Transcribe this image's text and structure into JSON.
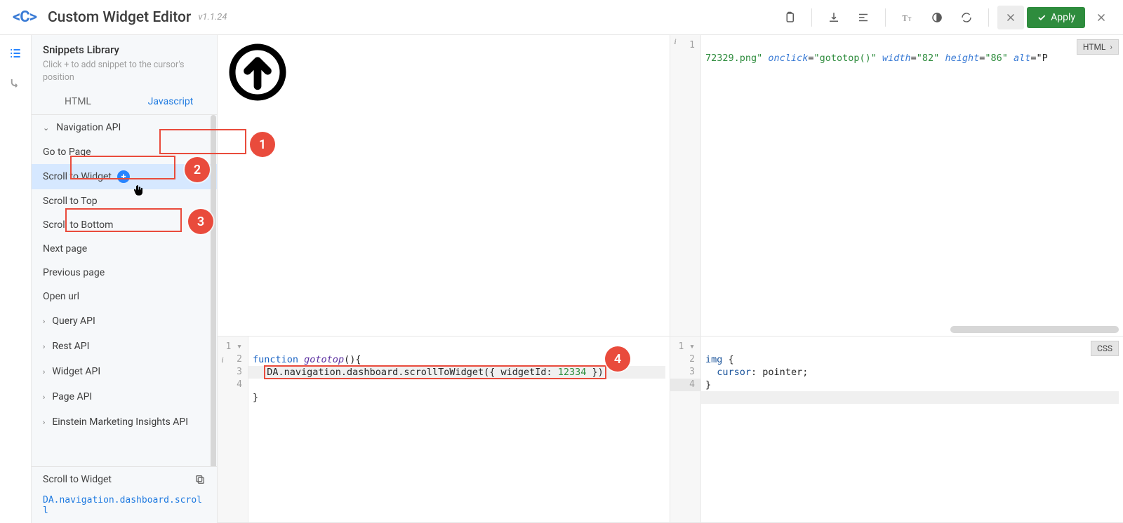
{
  "header": {
    "title": "Custom Widget Editor",
    "version": "v1.1.24",
    "apply_label": "Apply"
  },
  "sidebar": {
    "title": "Snippets Library",
    "hint": "Click + to add snippet to the cursor's position",
    "tabs": {
      "html": "HTML",
      "js": "Javascript"
    },
    "nav_api": "Navigation API",
    "items": {
      "go_to_page": "Go to Page",
      "scroll_to_widget": "Scroll to Widget",
      "scroll_to_top": "Scroll to Top",
      "scroll_to_bottom": "Scroll to Bottom",
      "next_page": "Next page",
      "previous_page": "Previous page",
      "open_url": "Open url"
    },
    "groups": {
      "query": "Query API",
      "rest": "Rest API",
      "widget": "Widget API",
      "page": "Page API",
      "einstein": "Einstein Marketing Insights API"
    },
    "preview_title": "Scroll to Widget",
    "preview_code": "DA.navigation.dashboard.scroll"
  },
  "panes": {
    "html": {
      "badge": "HTML",
      "line1_a": "72329.png\"",
      "line1_onclick": "onclick",
      "line1_onclick_v": "\"gototop()\"",
      "line1_width": "width",
      "line1_width_v": "\"82\"",
      "line1_height": "height",
      "line1_height_v": "\"86\"",
      "line1_alt": "alt",
      "line1_tail": "=\"P"
    },
    "js": {
      "line1_kw": "function",
      "line1_name": "gototop",
      "line1_tail": "(){",
      "line2_code": "DA.navigation.dashboard.scrollToWidget({ widgetId: ",
      "line2_num": "12334",
      "line2_end": " })",
      "line3": "}"
    },
    "css": {
      "badge": "CSS",
      "line1_sel": "img",
      "line1_open": " {",
      "line2_prop": "cursor",
      "line2_val": ": pointer;",
      "line3": "}"
    }
  },
  "callouts": {
    "c1": "1",
    "c2": "2",
    "c3": "3",
    "c4": "4"
  }
}
